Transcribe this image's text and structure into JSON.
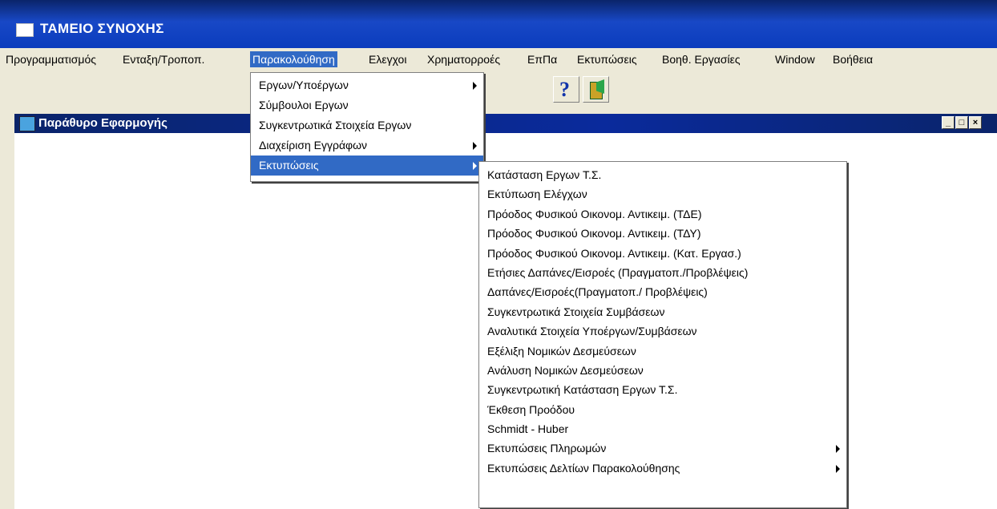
{
  "window": {
    "title": "ΤΑΜΕΙΟ ΣΥΝΟΧΗΣ"
  },
  "menubar": {
    "items": [
      "Προγραμματισμός",
      "Ενταξη/Τροποπ.",
      "Παρακολούθηση",
      "Ελεγχοι",
      "Χρηματορροές",
      "ΕπΠα",
      "Εκτυπώσεις",
      "Βοηθ. Εργασίες",
      "Window",
      "Βοήθεια"
    ]
  },
  "toolbar": {
    "help_glyph": "?",
    "icons": [
      "help-icon",
      "exit-door-icon"
    ]
  },
  "child_window": {
    "title": "Παράθυρο Εφαρμογής",
    "buttons": [
      "_",
      "□",
      "×"
    ]
  },
  "dropdown": {
    "items": [
      {
        "label": "Εργων/Υποέργων",
        "submenu": true
      },
      {
        "label": "Σύμβουλοι Εργων",
        "submenu": false
      },
      {
        "label": "Συγκεντρωτικά Στοιχεία Εργων",
        "submenu": false
      },
      {
        "label": "Διαχείριση Εγγράφων",
        "submenu": true
      },
      {
        "label": "Εκτυπώσεις",
        "submenu": true,
        "selected": true
      }
    ]
  },
  "submenu": {
    "items": [
      {
        "label": "Κατάσταση Εργων Τ.Σ.",
        "submenu": false
      },
      {
        "label": "Εκτύπωση Ελέγχων",
        "submenu": false
      },
      {
        "label": "Πρόοδος Φυσικού Οικονομ. Αντικειμ. (ΤΔΕ)",
        "submenu": false
      },
      {
        "label": "Πρόοδος Φυσικού Οικονομ. Αντικειμ. (ΤΔΥ)",
        "submenu": false
      },
      {
        "label": "Πρόοδος Φυσικού Οικονομ. Αντικειμ. (Κατ. Εργασ.)",
        "submenu": false
      },
      {
        "label": "Ετήσιες Δαπάνες/Εισροές (Πραγματοπ./Προβλέψεις)",
        "submenu": false
      },
      {
        "label": "Δαπάνες/Εισροές(Πραγματοπ./ Προβλέψεις)",
        "submenu": false
      },
      {
        "label": "Συγκεντρωτικά Στοιχεία Συμβάσεων",
        "submenu": false
      },
      {
        "label": "Αναλυτικά Στοιχεία Υποέργων/Συμβάσεων",
        "submenu": false
      },
      {
        "label": "Εξέλιξη Νομικών Δεσμεύσεων",
        "submenu": false
      },
      {
        "label": "Ανάλυση Νομικών Δεσμεύσεων",
        "submenu": false
      },
      {
        "label": "Συγκεντρωτική Κατάσταση Εργων Τ.Σ.",
        "submenu": false
      },
      {
        "label": "Έκθεση Προόδου",
        "submenu": false
      },
      {
        "label": "Schmidt - Huber",
        "submenu": false
      },
      {
        "label": "Εκτυπώσεις Πληρωμών",
        "submenu": true
      },
      {
        "label": "Εκτυπώσεις Δελτίων Παρακολούθησης",
        "submenu": true
      }
    ]
  }
}
